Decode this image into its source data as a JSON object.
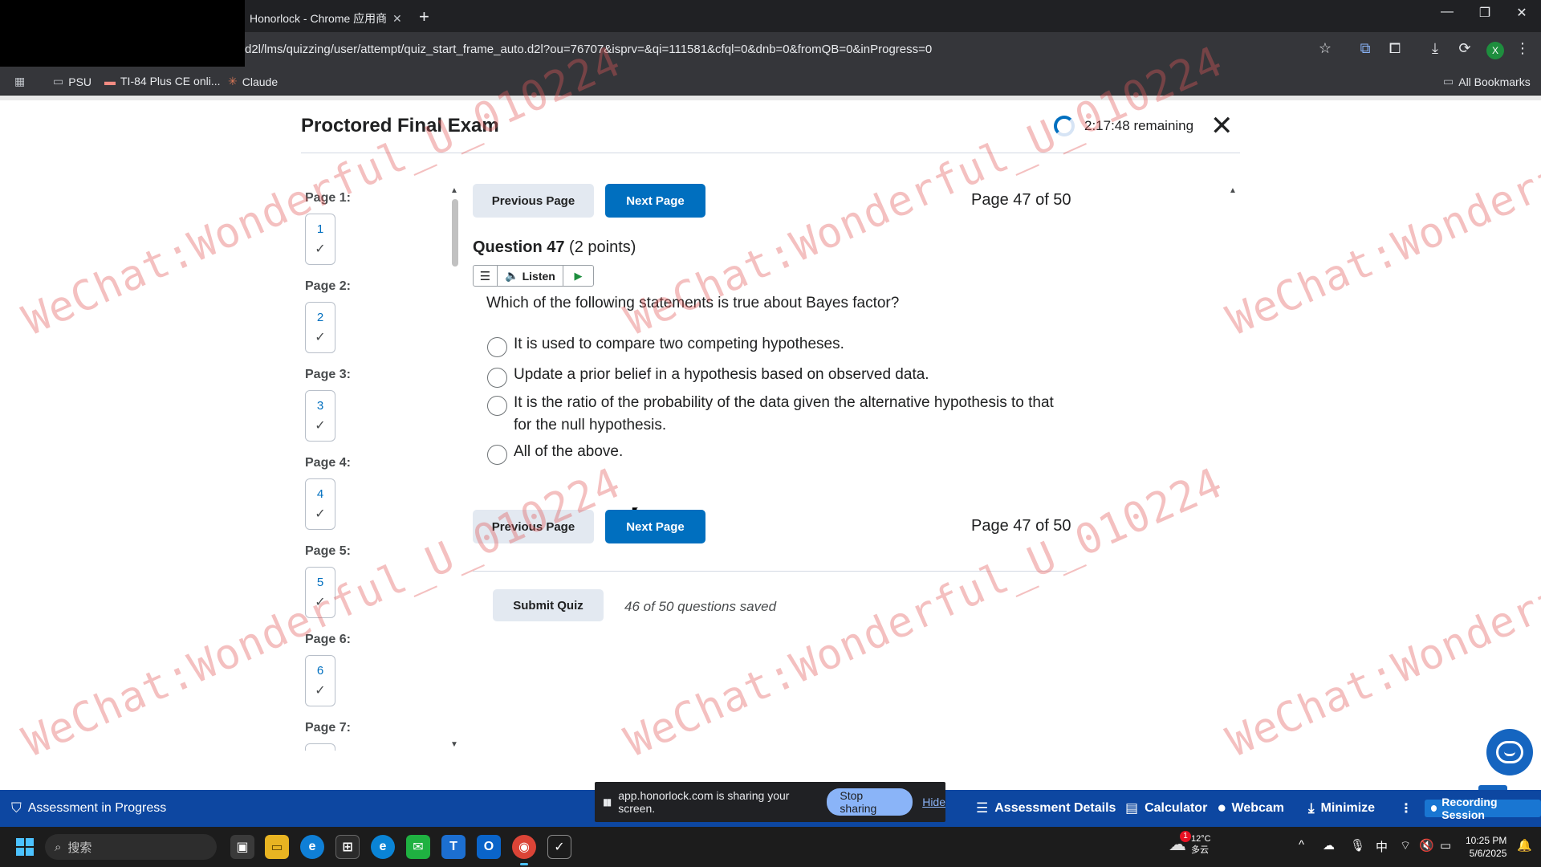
{
  "browser": {
    "tab_title": "Honorlock - Chrome 应用商店",
    "tab_close": "✕",
    "new_tab": "+",
    "url": "d2l/lms/quizzing/user/attempt/quiz_start_frame_auto.d2l?ou=76707&isprv=&qi=111581&cfql=0&dnb=0&fromQB=0&inProgress=0",
    "window_controls": {
      "minimize": "—",
      "restore": "❐",
      "close": "✕"
    },
    "profile_initial": "X",
    "bookmarks": [
      {
        "icon": "folder-icon",
        "label": "PSU"
      },
      {
        "icon": "bookmark-icon",
        "label": "TI-84 Plus CE onli..."
      },
      {
        "icon": "claude-icon",
        "label": "Claude"
      }
    ],
    "all_bookmarks": "All Bookmarks"
  },
  "exam": {
    "title": "Proctored Final Exam",
    "time_remaining": "2:17:48 remaining",
    "close": "✕"
  },
  "pagenav": {
    "pages": [
      {
        "label": "Page 1:",
        "number": "1",
        "check": "✓"
      },
      {
        "label": "Page 2:",
        "number": "2",
        "check": "✓"
      },
      {
        "label": "Page 3:",
        "number": "3",
        "check": "✓"
      },
      {
        "label": "Page 4:",
        "number": "4",
        "check": "✓"
      },
      {
        "label": "Page 5:",
        "number": "5",
        "check": "✓"
      },
      {
        "label": "Page 6:",
        "number": "6",
        "check": "✓"
      },
      {
        "label": "Page 7:",
        "number": "",
        "check": ""
      }
    ]
  },
  "question": {
    "prev_label": "Previous Page",
    "next_label": "Next Page",
    "page_indicator": "Page 47 of 50",
    "number_label": "Question 47",
    "points": "(2 points)",
    "listen_label": "Listen",
    "text": "Which of the following statements is true about Bayes factor?",
    "options": [
      "It is used to compare two competing hypotheses.",
      "Update a prior belief in a hypothesis based on observed data.",
      "It is the ratio of the probability of the data given the alternative hypothesis to that for the null hypothesis.",
      "All of the above."
    ]
  },
  "footer": {
    "submit_label": "Submit Quiz",
    "saved_status": "46 of 50 questions saved"
  },
  "honorlock": {
    "status": "Assessment in Progress",
    "assessment_details": "Assessment Details",
    "calculator": "Calculator",
    "webcam": "Webcam",
    "minimize": "Minimize",
    "recording": "Recording Session"
  },
  "share": {
    "message": "app.honorlock.com is sharing your screen.",
    "stop": "Stop sharing",
    "hide": "Hide"
  },
  "taskbar": {
    "search_placeholder": "搜索",
    "weather_temp": "12°C",
    "weather_desc": "多云",
    "weather_badge": "1",
    "ime": "中",
    "time": "10:25 PM",
    "date": "5/6/2025"
  },
  "watermark": "WeChat:Wonderful_U_010224",
  "colors": {
    "accent": "#006fbf",
    "honorlock_bar": "#0d47a1",
    "watermark": "#e15a5a"
  }
}
